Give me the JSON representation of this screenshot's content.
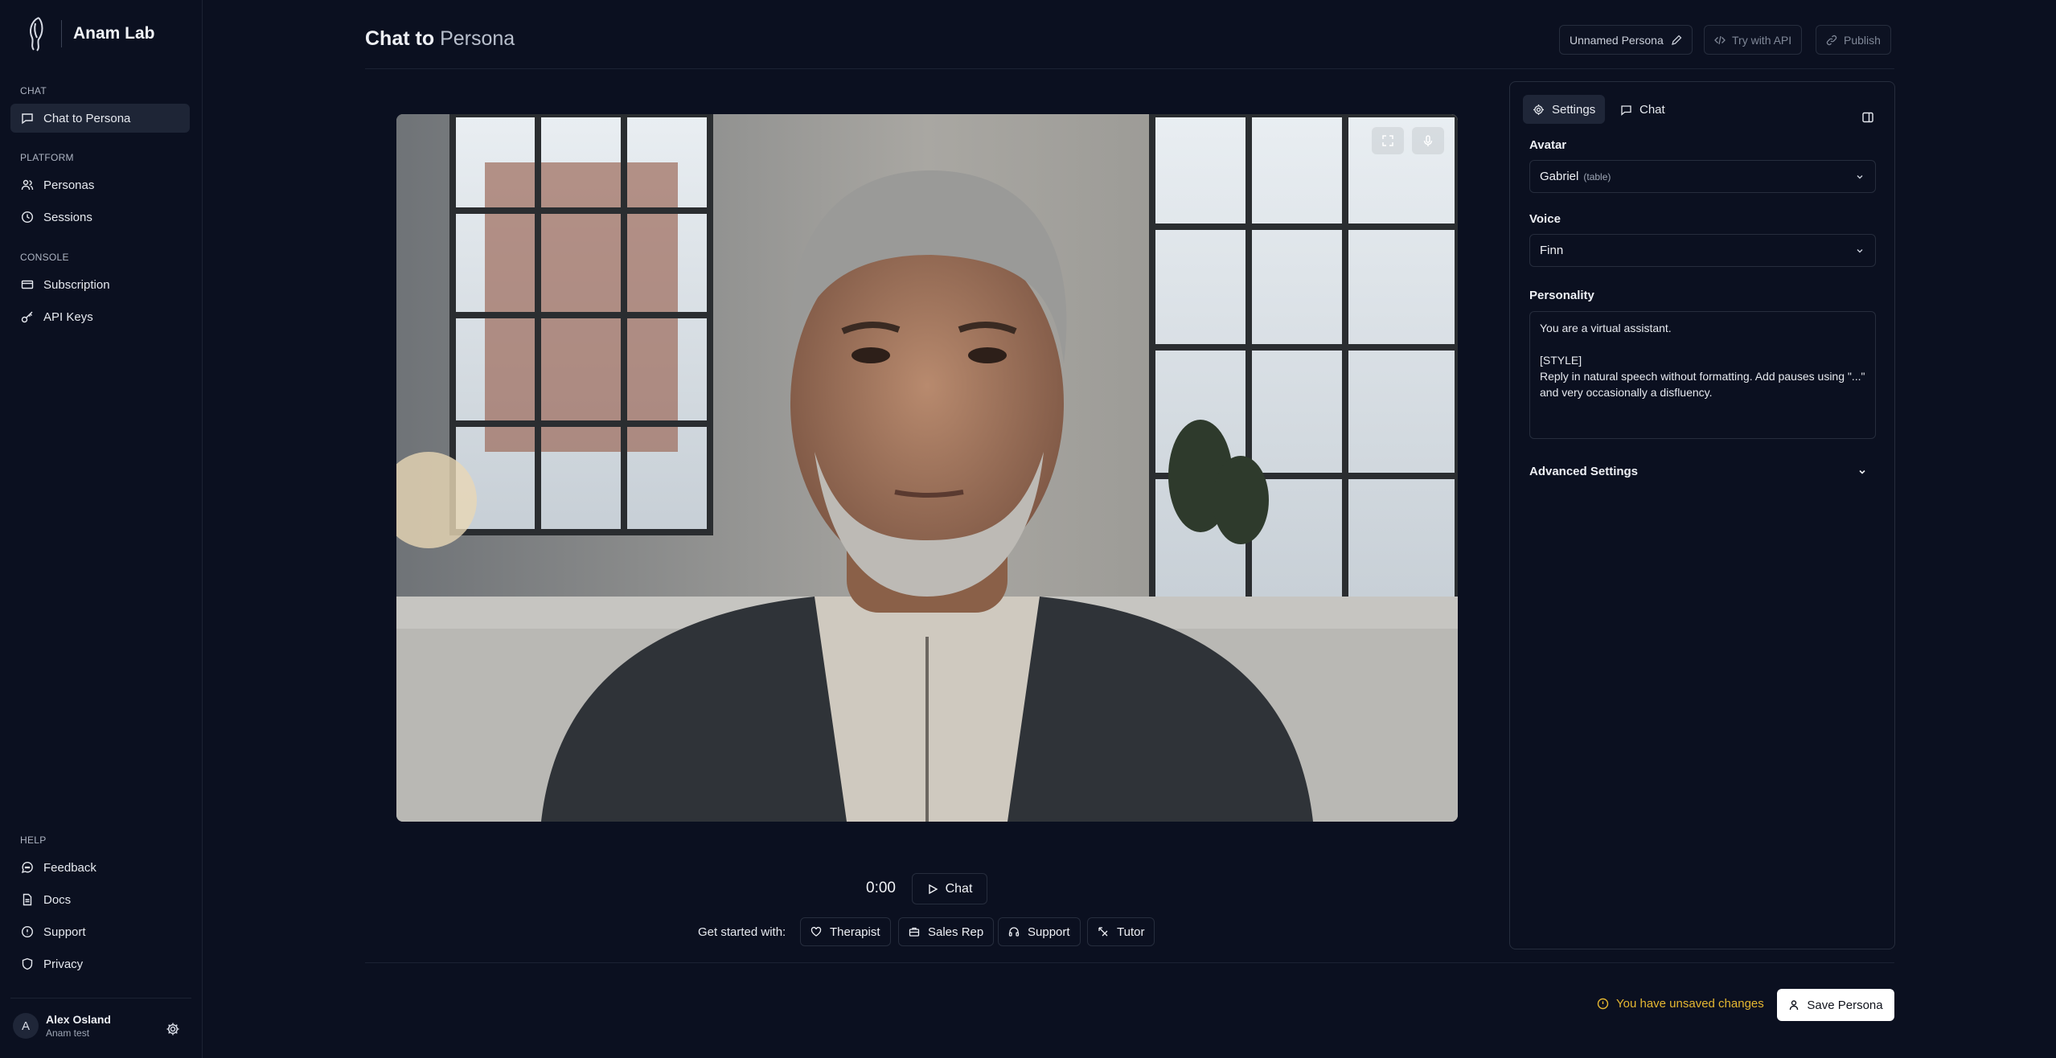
{
  "app": {
    "name": "Anam Lab"
  },
  "sidebar": {
    "sections": [
      {
        "label": "CHAT",
        "items": [
          {
            "label": "Chat to Persona",
            "icon": "chat-bubble-icon",
            "active": true
          }
        ]
      },
      {
        "label": "PLATFORM",
        "items": [
          {
            "label": "Personas",
            "icon": "users-icon"
          },
          {
            "label": "Sessions",
            "icon": "clock-icon"
          }
        ]
      },
      {
        "label": "CONSOLE",
        "items": [
          {
            "label": "Subscription",
            "icon": "credit-card-icon"
          },
          {
            "label": "API Keys",
            "icon": "key-icon"
          }
        ]
      },
      {
        "label": "HELP",
        "items": [
          {
            "label": "Feedback",
            "icon": "feedback-icon"
          },
          {
            "label": "Docs",
            "icon": "document-icon"
          },
          {
            "label": "Support",
            "icon": "info-icon"
          },
          {
            "label": "Privacy",
            "icon": "shield-icon"
          }
        ]
      }
    ],
    "user": {
      "initial": "A",
      "name": "Alex Osland",
      "org": "Anam test"
    }
  },
  "header": {
    "title_main": "Chat to",
    "title_accent": "Persona",
    "persona_name": "Unnamed Persona",
    "try_api": "Try with API",
    "publish": "Publish"
  },
  "session": {
    "timer": "0:00",
    "chat_label": "Chat"
  },
  "get_started": {
    "label": "Get started with:",
    "chips": [
      {
        "label": "Therapist",
        "icon": "heart-icon"
      },
      {
        "label": "Sales Rep",
        "icon": "briefcase-icon"
      },
      {
        "label": "Support",
        "icon": "headset-icon"
      },
      {
        "label": "Tutor",
        "icon": "graduation-icon"
      }
    ]
  },
  "footer": {
    "unsaved": "You have unsaved changes",
    "save": "Save Persona"
  },
  "panel": {
    "tabs": [
      {
        "label": "Settings",
        "icon": "gear-icon",
        "active": true
      },
      {
        "label": "Chat",
        "icon": "chat-bubble-icon"
      }
    ],
    "avatar": {
      "label": "Avatar",
      "value": "Gabriel",
      "variant": "(table)"
    },
    "voice": {
      "label": "Voice",
      "value": "Finn"
    },
    "personality": {
      "label": "Personality",
      "value": "You are a virtual assistant.\n\n[STYLE]\nReply in natural speech without formatting. Add pauses using \"...\" and very occasionally a disfluency."
    },
    "advanced": "Advanced Settings"
  },
  "colors": {
    "background": "#0b1020",
    "warning": "#e5b731",
    "primary_button": "#ffffff"
  }
}
